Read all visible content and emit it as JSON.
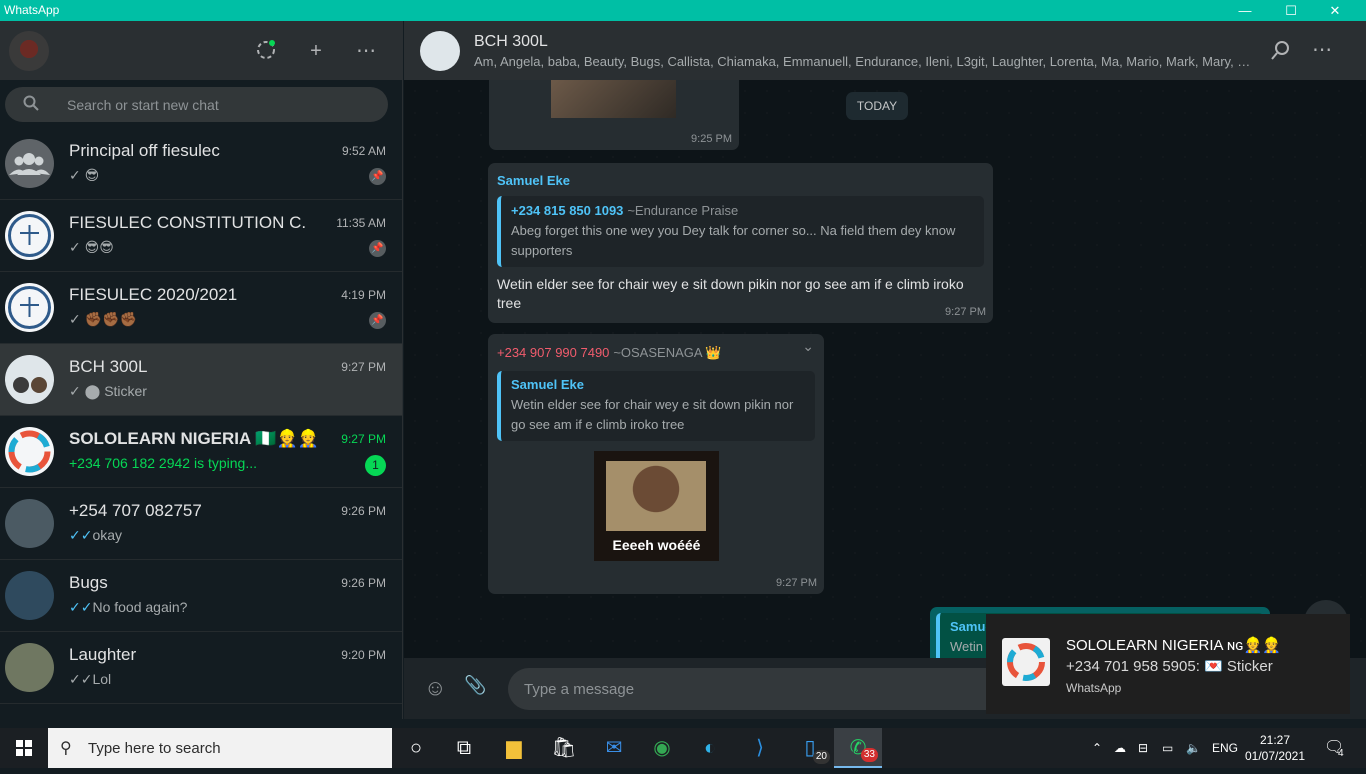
{
  "window": {
    "title": "WhatsApp",
    "minimize": "—",
    "maximize": "☐",
    "close": "✕"
  },
  "sidebar_header": {
    "status_icon": "status-icon",
    "new_chat": "+",
    "menu": "⋯"
  },
  "search": {
    "placeholder": "Search or start new chat",
    "icon": "⚲"
  },
  "chats": [
    {
      "name": "Principal off fiesulec",
      "time": "9:52 AM",
      "tick": "✓",
      "message": "😎",
      "pinned": true
    },
    {
      "name": "FIESULEC CONSTITUTION C.",
      "time": "11:35 AM",
      "tick": "✓",
      "message": "😎😎",
      "pinned": true
    },
    {
      "name": "FIESULEC 2020/2021",
      "time": "4:19 PM",
      "tick": "✓",
      "message": "✊🏾✊🏾✊🏾",
      "pinned": true
    },
    {
      "name": "BCH 300L",
      "time": "9:27 PM",
      "tick": "✓",
      "message": "Sticker",
      "active": true
    },
    {
      "name": "SOLOLEARN NIGERIA 🇳🇬👷👷",
      "time": "9:27 PM",
      "message": "+234 706 182 2942 is typing...",
      "unread": "1"
    },
    {
      "name": "+254 707 082757",
      "time": "9:26 PM",
      "tick": "✓✓",
      "message": "okay"
    },
    {
      "name": "Bugs",
      "time": "9:26 PM",
      "tick": "✓✓",
      "message": "No food again?"
    },
    {
      "name": "Laughter",
      "time": "9:20 PM",
      "tick": "✓✓",
      "message": "Lol"
    }
  ],
  "conversation": {
    "title": "BCH 300L",
    "members": "Am, Angela, baba, Beauty, Bugs, Callista, Chiamaka, Emmanuell, Endurance, Ileni, L3git, Laughter, Lorenta, Ma, Mario, Mark, Mary, My...",
    "date_divider": "TODAY",
    "messages": [
      {
        "time": "9:25 PM"
      },
      {
        "sender": "Samuel Eke",
        "quote_phone": "+234 815 850 1093",
        "quote_name": "~Endurance Praise",
        "quote_text": "Abeg forget this one wey you Dey talk for corner so... Na field them dey know supporters",
        "text": "Wetin elder see for chair wey e sit down pikin nor go see am if e climb iroko tree",
        "time": "9:27 PM"
      },
      {
        "sender_phone": "+234 907 990 7490",
        "sender_name": "~OSASENAGA 👑",
        "quote_name": "Samuel Eke",
        "quote_text": "Wetin elder see for chair wey e sit down pikin nor go see am if e climb iroko tree",
        "sticker_caption": "Eeeeh woééé",
        "time": "9:27 PM"
      },
      {
        "quote_name": "Samuel",
        "quote_text": "Wetin e"
      }
    ]
  },
  "composer": {
    "placeholder": "Type a message",
    "emoji_icon": "☺",
    "attach_icon": "📎"
  },
  "notification": {
    "title": "SOLOLEARN NIGERIA ɴɢ👷👷",
    "body": "+234 701 958 5905: 💌 Sticker",
    "app": "WhatsApp"
  },
  "taskbar": {
    "search_placeholder": "Type here to search",
    "files_count": "20",
    "whatsapp_count": "33",
    "language": "ENG",
    "time": "21:27",
    "date": "01/07/2021",
    "notifications_count": "4"
  },
  "colors": {
    "accent": "#00bfa5",
    "unread": "#06d755",
    "link_blue": "#4fc3f7",
    "phone_red": "#f15c6d"
  }
}
